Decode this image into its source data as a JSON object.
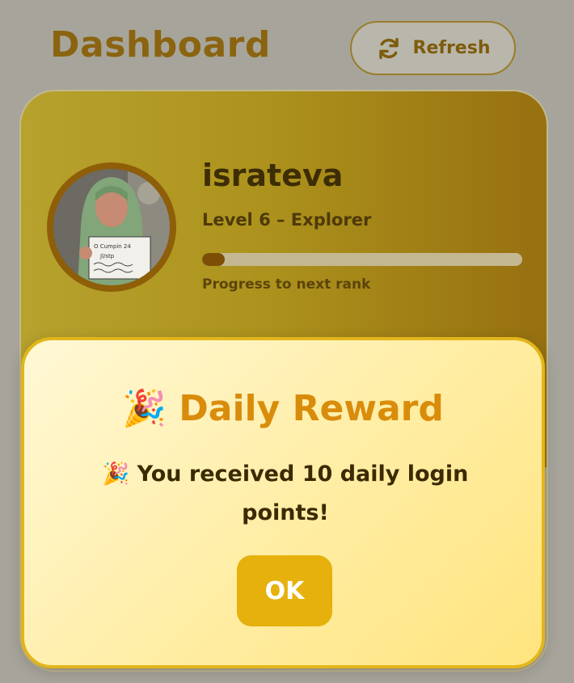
{
  "header": {
    "title": "Dashboard",
    "refresh_label": "Refresh",
    "refresh_icon": "refresh-icon"
  },
  "profile": {
    "username": "israteva",
    "level_text": "Level 6 – Explorer",
    "progress_fraction": 0.07,
    "progress_label": "Progress to next rank",
    "avatar_sign_text": "O Cumpin 24 Jl/stp"
  },
  "reward_modal": {
    "title": "🎉 Daily Reward",
    "message": "🎉 You received 10 daily login points!",
    "ok_label": "OK"
  },
  "colors": {
    "brand_gold": "#e6b10c",
    "title_brown": "#8a6410",
    "modal_title_orange": "#d98c0b"
  }
}
